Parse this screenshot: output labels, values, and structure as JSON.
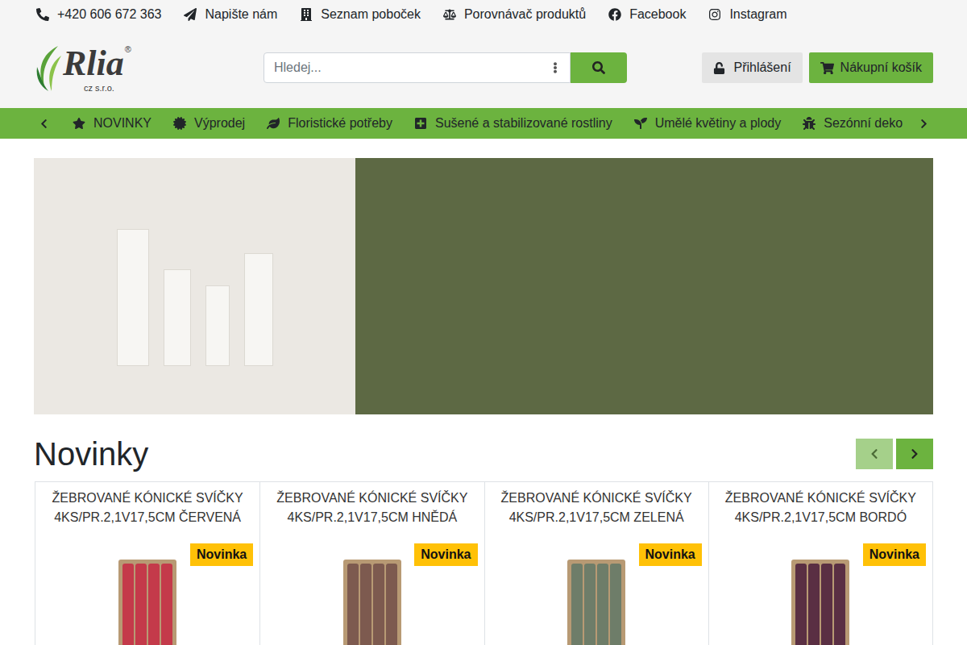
{
  "top_links": [
    {
      "label": "+420 606 672 363"
    },
    {
      "label": "Napište nám"
    },
    {
      "label": "Seznam poboček"
    },
    {
      "label": "Porovnávač produktů"
    },
    {
      "label": "Facebook"
    },
    {
      "label": "Instagram"
    }
  ],
  "logo": {
    "name": "Rlia",
    "suffix": "cz s.r.o.",
    "mark": "®"
  },
  "search": {
    "placeholder": "Hledej..."
  },
  "account": {
    "login": "Přihlášení",
    "cart": "Nákupní košík"
  },
  "nav": {
    "items": [
      {
        "label": "NOVINKY"
      },
      {
        "label": "Výprodej"
      },
      {
        "label": "Floristické potřeby"
      },
      {
        "label": "Sušené a stabilizované rostliny"
      },
      {
        "label": "Umělé květiny a plody"
      },
      {
        "label": "Sezónní deko"
      }
    ]
  },
  "section": {
    "title": "Novinky"
  },
  "carousel": {
    "prev": {
      "disabled": true
    },
    "next": {
      "disabled": false
    }
  },
  "products": [
    {
      "title": "ŽEBROVANÉ KÓNICKÉ SVÍČKY 4KS/PR.2,1V17,5CM ČERVENÁ",
      "badge": "Novinka",
      "color": "#c43a4a"
    },
    {
      "title": "ŽEBROVANÉ KÓNICKÉ SVÍČKY 4KS/PR.2,1V17,5CM HNĚDÁ",
      "badge": "Novinka",
      "color": "#7d5a4f"
    },
    {
      "title": "ŽEBROVANÉ KÓNICKÉ SVÍČKY 4KS/PR.2,1V17,5CM ZELENÁ",
      "badge": "Novinka",
      "color": "#6e7d69"
    },
    {
      "title": "ŽEBROVANÉ KÓNICKÉ SVÍČKY 4KS/PR.2,1V17,5CM BORDÓ",
      "badge": "Novinka",
      "color": "#5a2f43"
    }
  ]
}
